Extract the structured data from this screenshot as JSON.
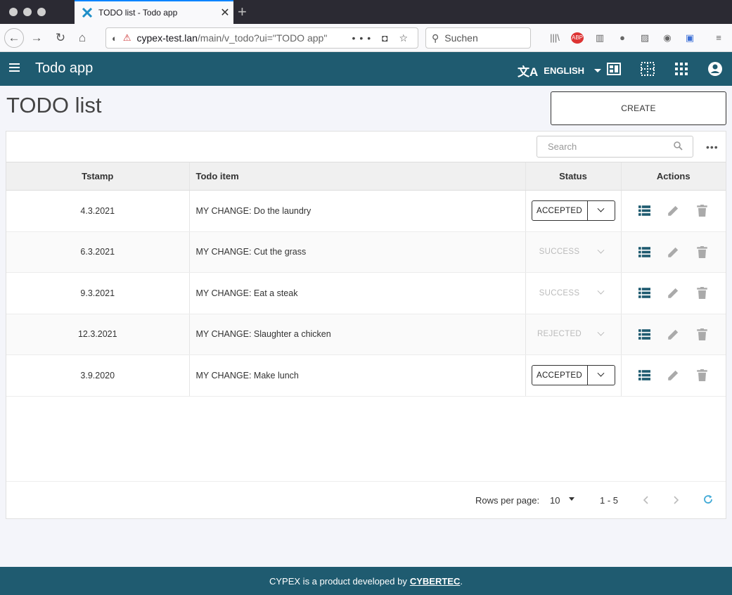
{
  "browser": {
    "tab_title": "TODO list - Todo app",
    "url_host": "cypex-test.lan",
    "url_path": "/main/v_todo?ui=\"TODO app\"",
    "search_placeholder": "Suchen",
    "icons": [
      "library-icon",
      "adblock-icon",
      "reader-icon",
      "extension-icon",
      "image-icon",
      "account-icon",
      "container-icon",
      "menu-icon"
    ]
  },
  "appbar": {
    "title": "Todo app",
    "language": "ENGLISH",
    "bg_color": "#1f5b70"
  },
  "page": {
    "title": "TODO list",
    "create_label": "CREATE"
  },
  "table": {
    "search_placeholder": "Search",
    "columns": {
      "tstamp": "Tstamp",
      "item": "Todo item",
      "status": "Status",
      "actions": "Actions"
    },
    "rows": [
      {
        "tstamp": "4.3.2021",
        "item": "MY CHANGE: Do the laundry",
        "status": "ACCEPTED",
        "enabled": true
      },
      {
        "tstamp": "6.3.2021",
        "item": "MY CHANGE: Cut the grass",
        "status": "SUCCESS",
        "enabled": false
      },
      {
        "tstamp": "9.3.2021",
        "item": "MY CHANGE: Eat a steak",
        "status": "SUCCESS",
        "enabled": false
      },
      {
        "tstamp": "12.3.2021",
        "item": "MY CHANGE: Slaughter a chicken",
        "status": "REJECTED",
        "enabled": false
      },
      {
        "tstamp": "3.9.2020",
        "item": "MY CHANGE: Make lunch",
        "status": "ACCEPTED",
        "enabled": true
      }
    ],
    "pagination": {
      "rows_per_page_label": "Rows per page:",
      "rows_per_page": "10",
      "range": "1 - 5"
    }
  },
  "footer": {
    "text": "CYPEX is a product developed by",
    "link": "CYBERTEC",
    "suffix": "."
  },
  "colors": {
    "accent": "#1f5b70",
    "icon_blue": "#1f5b70",
    "refresh": "#3fa9d6"
  }
}
